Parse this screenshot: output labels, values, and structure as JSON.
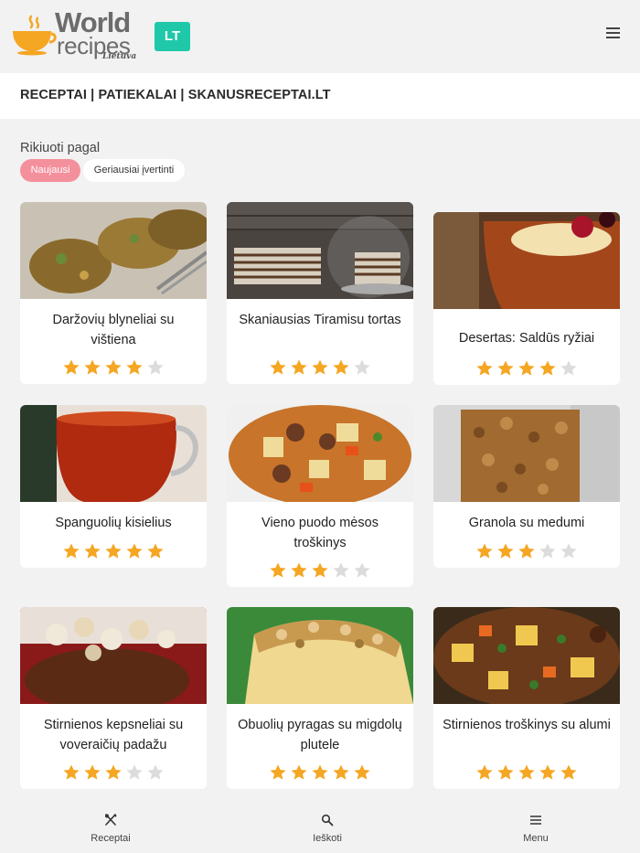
{
  "header": {
    "logo_word1": "World",
    "logo_word2": "recipes",
    "logo_sub": "Lietuva",
    "lang_label": "LT",
    "menu_icon": "hamburger-icon"
  },
  "title_bar": {
    "title": "RECEPTAI | PATIEKALAI | SKANUSRECEPTAI.LT"
  },
  "sort": {
    "label": "Rikiuoti pagal",
    "options": [
      "Naujausi",
      "Geriausiai įvertinti"
    ],
    "active": "Naujausi"
  },
  "colors": {
    "accent_teal": "#1fc8a8",
    "pill_active": "#f4909c",
    "star_filled": "#f5a623",
    "star_empty": "#dcdcdc"
  },
  "recipes": [
    {
      "name": "Daržovių blyneliai su vištiena",
      "rating": 4
    },
    {
      "name": "Skaniausias Tiramisu tortas",
      "rating": 4
    },
    {
      "name": "Desertas: Saldūs ryžiai",
      "rating": 4
    },
    {
      "name": "Spanguolių kisielius",
      "rating": 5
    },
    {
      "name": "Vieno puodo mėsos troškinys",
      "rating": 3
    },
    {
      "name": "Granola su medumi",
      "rating": 3
    },
    {
      "name": "Stirnienos kepsneliai su voveraičių padažu",
      "rating": 3
    },
    {
      "name": "Obuolių pyragas su migdolų plutele",
      "rating": 5
    },
    {
      "name": "Stirnienos troškinys su alumi",
      "rating": 5
    }
  ],
  "bottom_nav": [
    {
      "label": "Receptai",
      "icon": "cutlery-icon"
    },
    {
      "label": "Ieškoti",
      "icon": "search-icon"
    },
    {
      "label": "Menu",
      "icon": "hamburger-icon"
    }
  ]
}
